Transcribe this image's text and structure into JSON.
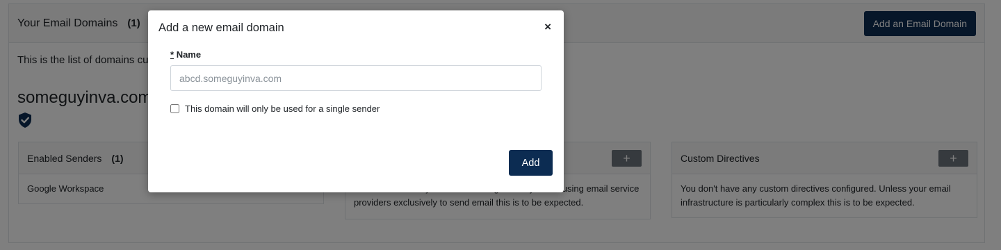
{
  "background": {
    "panel_title": "Your Email Domains",
    "panel_count": "(1)",
    "add_domain_button": "Add an Email Domain",
    "intro_text": "This is the list of domains cu",
    "domain_name": "someguyinva.com",
    "cards": {
      "enabled_senders": {
        "title": "Enabled Senders",
        "count": "(1)",
        "items": [
          "Google Workspace"
        ]
      },
      "middle": {
        "plus_label": "+",
        "body": "You don't have any resources configured. If you are using email service providers exclusively to send email this is to be expected."
      },
      "custom_directives": {
        "title": "Custom Directives",
        "plus_label": "+",
        "body": "You don't have any custom directives configured. Unless your email infrastructure is particularly complex this is to be expected."
      }
    }
  },
  "modal": {
    "title": "Add a new email domain",
    "close_symbol": "×",
    "required_mark": "*",
    "name_label": "Name",
    "name_placeholder": "abcd.someguyinva.com",
    "name_value": "",
    "single_sender_label": "This domain will only be used for a single sender",
    "single_sender_checked": false,
    "add_button": "Add"
  },
  "colors": {
    "primary": "#0c2c52",
    "secondary": "#6c757d"
  }
}
